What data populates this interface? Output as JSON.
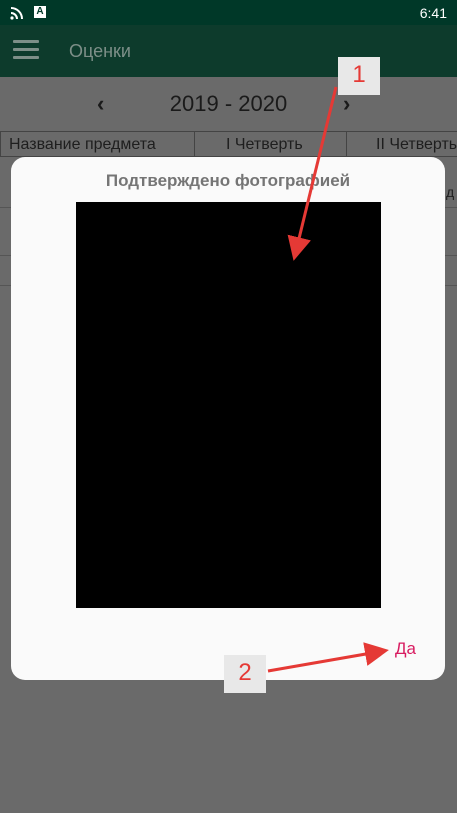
{
  "status_bar": {
    "time": "6:41",
    "a_icon": "A"
  },
  "app_bar": {
    "title": "Оценки"
  },
  "year_nav": {
    "prev": "‹",
    "label": "2019 - 2020",
    "next": "›"
  },
  "table": {
    "headers": [
      "Название предмета",
      "I Четверть",
      "II Четверть"
    ],
    "cell_fragment": "д"
  },
  "dialog": {
    "title": "Подтверждено фотографией",
    "yes_label": "Да"
  },
  "annotations": {
    "one": "1",
    "two": "2",
    "color": "#e53935"
  }
}
